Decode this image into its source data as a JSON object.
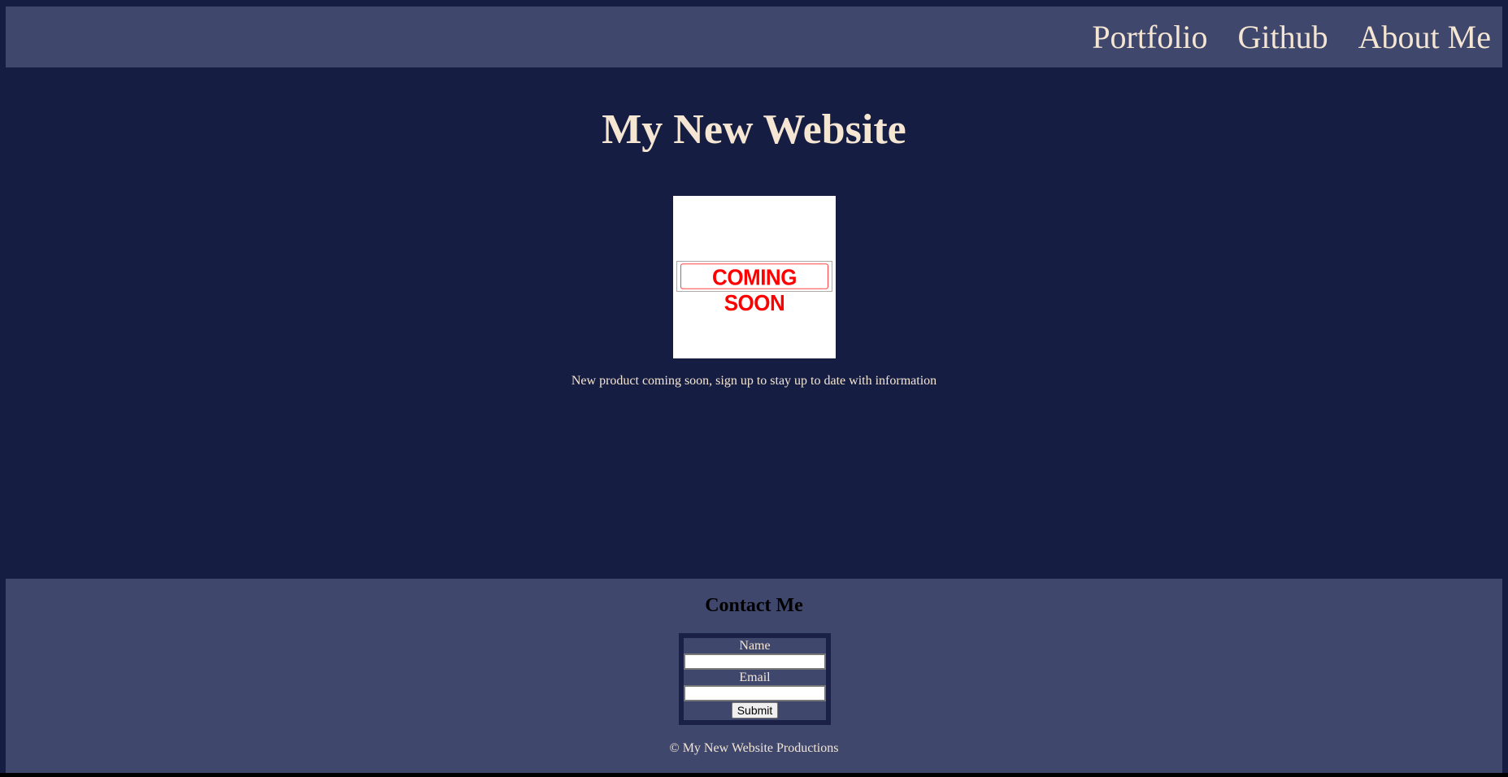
{
  "nav": {
    "items": [
      "Portfolio",
      "Github",
      "About Me"
    ]
  },
  "main": {
    "title": "My New Website",
    "image_text": "COMING SOON",
    "description": "New product coming soon, sign up to stay up to date with information"
  },
  "footer": {
    "heading": "Contact Me",
    "form": {
      "name_label": "Name",
      "name_value": "",
      "email_label": "Email",
      "email_value": "",
      "submit_label": "Submit"
    },
    "copyright": "© My New Website Productions"
  }
}
